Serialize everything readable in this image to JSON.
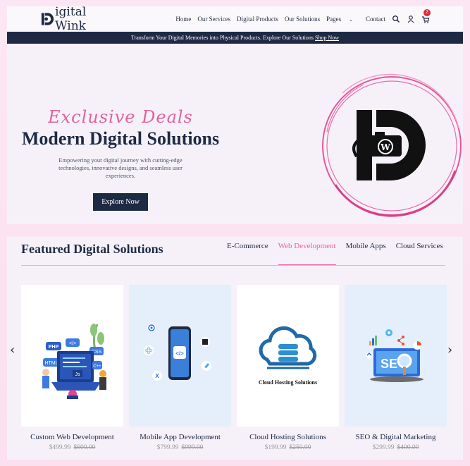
{
  "header": {
    "brand": "igital Wink",
    "nav": [
      "Home",
      "Our Services",
      "Digital Products",
      "Our Solutions",
      "Pages",
      "Contact"
    ],
    "cart_count": "2"
  },
  "promo": {
    "text": "Transform Your Digital Memories into Physical Products. Explore Our Solutions",
    "link": "Shop Now"
  },
  "hero": {
    "script": "Exclusive Deals",
    "title": "Modern Digital Solutions",
    "description": "Empowering your digital journey with cutting-edge technologies, innovative designs, and seamless user experiences.",
    "button": "Explore Now"
  },
  "featured": {
    "title": "Featured Digital Solutions",
    "tabs": [
      "E-Commerce",
      "Web Development",
      "Mobile Apps",
      "Cloud Services"
    ],
    "active_tab": "Web Development",
    "products": [
      {
        "name": "Custom Web Development",
        "price": "$499.99",
        "old_price": "$600.00"
      },
      {
        "name": "Mobile App Development",
        "price": "$799.99",
        "old_price": "$999.00"
      },
      {
        "name": "Cloud Hosting Solutions",
        "price": "$199.99",
        "old_price": "$250.00",
        "image_caption": "Cloud Hosting Solutions"
      },
      {
        "name": "SEO & Digital Marketing",
        "price": "$299.99",
        "old_price": "$400.00"
      }
    ]
  },
  "colors": {
    "navy": "#1e2a44",
    "pink": "#e2629d",
    "page_bg": "#fde6f3"
  }
}
